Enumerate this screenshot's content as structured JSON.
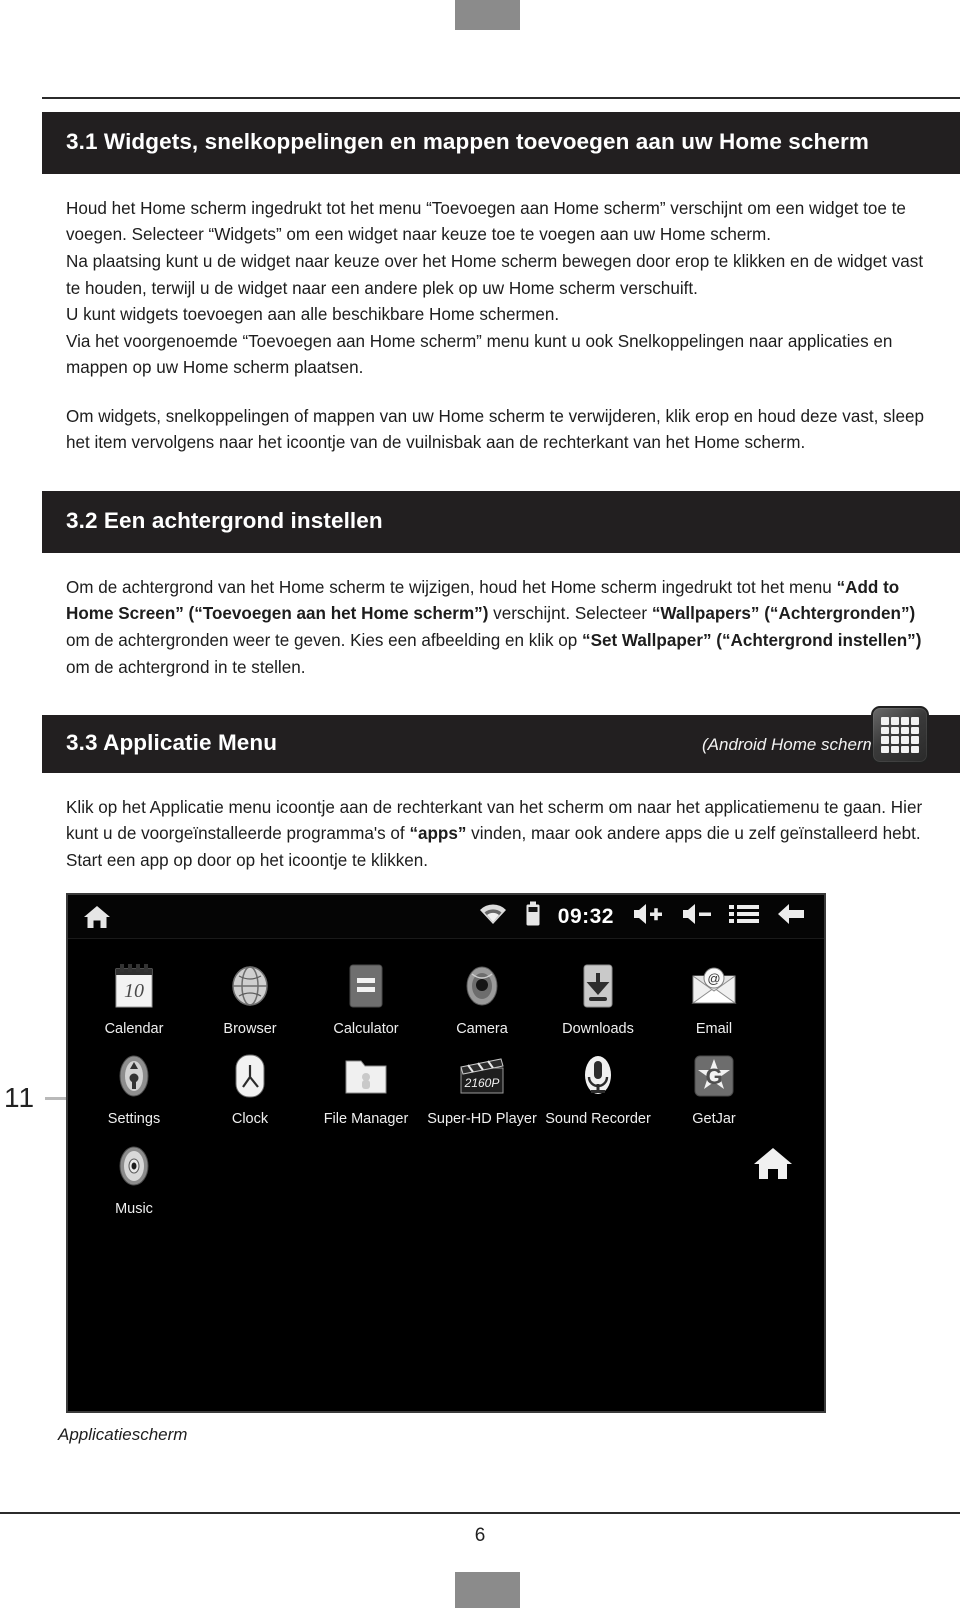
{
  "page": {
    "folio": "6",
    "margin_page_marker": "11",
    "figure_caption": "Applicatiescherm"
  },
  "sections": [
    {
      "heading": "3.1 Widgets, snelkoppelingen en mappen toevoegen aan uw Home scherm",
      "paragraphs": [
        "Houd het Home scherm ingedrukt tot het menu “Toevoegen aan Home scherm” verschijnt om een widget toe te voegen. Selecteer “Widgets” om een widget naar keuze toe te voegen aan uw Home scherm.",
        "Na plaatsing kunt u de widget naar keuze over het Home scherm bewegen door erop te klikken en de widget vast te houden, terwijl u de widget naar een andere plek op uw Home scherm verschuift.",
        "U kunt widgets toevoegen aan alle beschikbare Home schermen.",
        "Via het voorgenoemde “Toevoegen aan Home scherm” menu kunt u ook Snelkoppelingen naar applicaties en mappen op uw Home scherm plaatsen.",
        "Om widgets, snelkoppelingen of mappen van uw Home scherm te verwijderen, klik erop en houd deze vast, sleep het item vervolgens naar het icoontje van de vuilnisbak aan de rechterkant van het Home scherm."
      ]
    },
    {
      "heading": "3.2 Een achtergrond instellen",
      "body_runs": [
        {
          "text": "Om de achtergrond van het Home scherm te wijzigen, houd het Home scherm ingedrukt tot het menu ",
          "bold": false
        },
        {
          "text": "“Add to Home Screen” (“Toevoegen aan het Home scherm”)",
          "bold": true
        },
        {
          "text": " verschijnt. Selecteer ",
          "bold": false
        },
        {
          "text": "“Wallpapers” (“Achtergronden”)",
          "bold": true
        },
        {
          "text": " om de achtergronden weer te geven. Kies een afbeelding en klik op ",
          "bold": false
        },
        {
          "text": "“Set Wallpaper” (“Achtergrond instellen”)",
          "bold": true
        },
        {
          "text": " om de achtergrond in te stellen.",
          "bold": false
        }
      ]
    },
    {
      "heading": "3.3 Applicatie Menu",
      "note": "(Android Home scherm nr. 10)",
      "body_runs": [
        {
          "text": "Klik op het Applicatie menu icoontje aan de rechterkant van het scherm om naar het applicatiemenu te gaan. Hier kunt u de voorgeïnstalleerde programma's of ",
          "bold": false
        },
        {
          "text": "“apps”",
          "bold": true
        },
        {
          "text": " vinden, maar ook andere apps die u zelf geïnstalleerd hebt. Start een app op door op het icoontje te klikken.",
          "bold": false
        }
      ]
    }
  ],
  "app_menu_badge": {
    "icon": "app-grid-icon",
    "dot_count": 16
  },
  "screenshot": {
    "statusbar": {
      "home_icon": "home-icon",
      "wifi_icon": "wifi-icon",
      "battery_icon": "battery-icon",
      "clock": "09:32",
      "volume_up_icon": "volume-up-icon",
      "volume_down_icon": "volume-down-icon",
      "menu_icon": "menu-list-icon",
      "back_icon": "back-arrow-icon"
    },
    "rows": [
      [
        {
          "label": "Calendar",
          "icon": "calendar-icon"
        },
        {
          "label": "Browser",
          "icon": "globe-icon"
        },
        {
          "label": "Calculator",
          "icon": "calculator-icon"
        },
        {
          "label": "Camera",
          "icon": "camera-icon"
        },
        {
          "label": "Downloads",
          "icon": "download-icon"
        },
        {
          "label": "Email",
          "icon": "email-icon"
        }
      ],
      [
        {
          "label": "Settings",
          "icon": "settings-icon"
        },
        {
          "label": "Clock",
          "icon": "clock-icon"
        },
        {
          "label": "File Manager",
          "icon": "folder-icon"
        },
        {
          "label": "Super-HD Player",
          "icon": "clapperboard-icon"
        },
        {
          "label": "Sound Recorder",
          "icon": "microphone-icon"
        },
        {
          "label": "GetJar",
          "icon": "getjar-icon"
        }
      ],
      [
        {
          "label": "Music",
          "icon": "speaker-icon"
        }
      ]
    ],
    "home_shortcut_icon": "home-icon"
  },
  "colors": {
    "bar_background": "#221f20",
    "screen_background": "#000000",
    "text": "#1d1d1d"
  }
}
